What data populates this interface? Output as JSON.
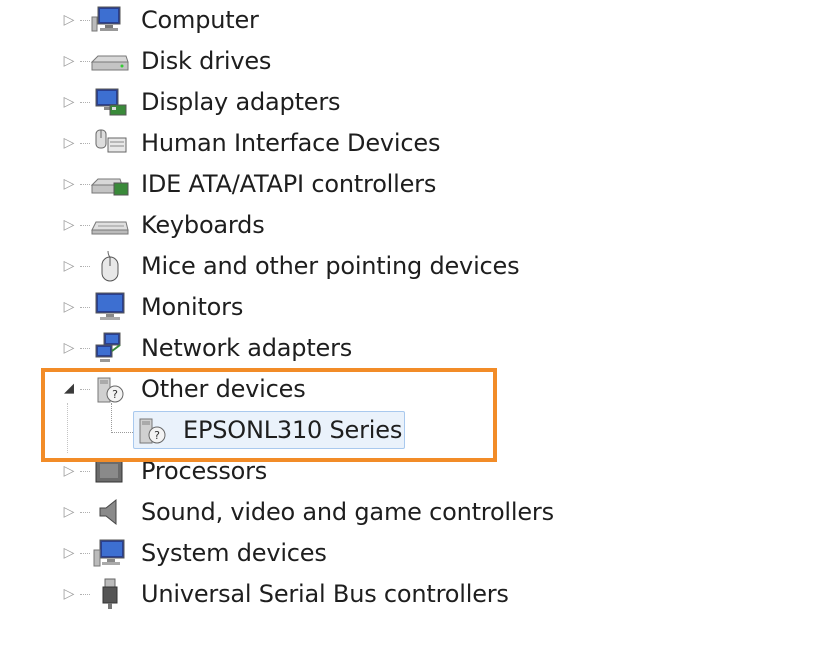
{
  "device_tree": {
    "categories": [
      {
        "label": "Computer",
        "icon": "computer-icon"
      },
      {
        "label": "Disk drives",
        "icon": "disk-drive-icon"
      },
      {
        "label": "Display adapters",
        "icon": "display-adapter-icon"
      },
      {
        "label": "Human Interface Devices",
        "icon": "hid-icon"
      },
      {
        "label": "IDE ATA/ATAPI controllers",
        "icon": "ide-controller-icon"
      },
      {
        "label": "Keyboards",
        "icon": "keyboard-icon"
      },
      {
        "label": "Mice and other pointing devices",
        "icon": "mouse-icon"
      },
      {
        "label": "Monitors",
        "icon": "monitor-icon"
      },
      {
        "label": "Network adapters",
        "icon": "network-adapter-icon"
      },
      {
        "label": "Other devices",
        "icon": "unknown-device-icon",
        "expanded": true
      },
      {
        "label": "Processors",
        "icon": "processor-icon"
      },
      {
        "label": "Sound, video and game controllers",
        "icon": "speaker-icon"
      },
      {
        "label": "System devices",
        "icon": "system-device-icon"
      },
      {
        "label": "Universal Serial Bus controllers",
        "icon": "usb-icon"
      }
    ],
    "other_devices_children": [
      {
        "label": "EPSONL310 Series",
        "icon": "unknown-device-icon",
        "selected": true
      }
    ]
  },
  "colors": {
    "highlight_border": "#f28c28",
    "selection_fill": "#eaf2fb",
    "selection_border": "#a9c9ee"
  }
}
